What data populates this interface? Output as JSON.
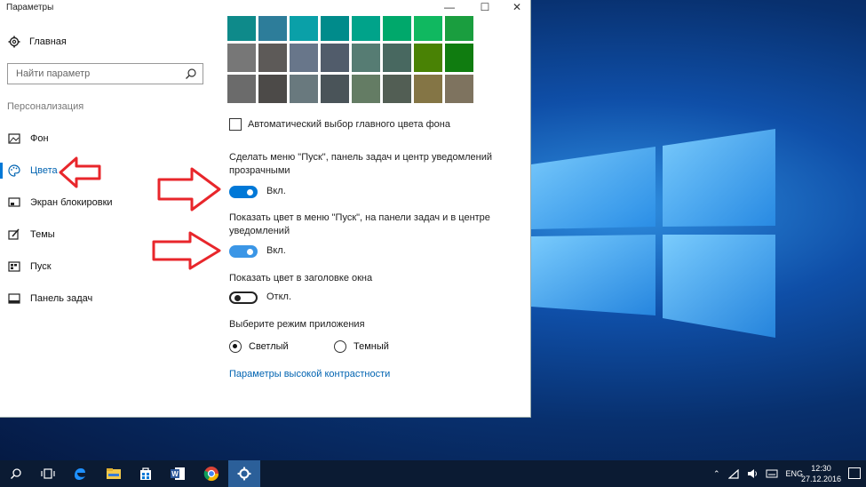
{
  "window": {
    "title": "Параметры",
    "minimize_glyph": "—",
    "maximize_glyph": "☐",
    "close_glyph": "✕"
  },
  "sidebar": {
    "home_label": "Главная",
    "search_placeholder": "Найти параметр",
    "section_title": "Персонализация",
    "items": [
      {
        "label": "Фон",
        "icon": "image-icon"
      },
      {
        "label": "Цвета",
        "icon": "palette-icon",
        "active": true
      },
      {
        "label": "Экран блокировки",
        "icon": "lock-screen-icon"
      },
      {
        "label": "Темы",
        "icon": "themes-icon"
      },
      {
        "label": "Пуск",
        "icon": "start-icon"
      },
      {
        "label": "Панель задач",
        "icon": "taskbar-icon"
      }
    ]
  },
  "colors": {
    "swatch_rows": [
      [
        "#0e8a8a",
        "#2d7d9a",
        "#0aa0a8",
        "#008b8b",
        "#00a38a",
        "#00a86b",
        "#10b860",
        "#1a9e3f"
      ],
      [
        "#777777",
        "#5d5a58",
        "#68768a",
        "#515c6b",
        "#567c73",
        "#486860",
        "#498205",
        "#107c10"
      ],
      [
        "#6b6b6b",
        "#4c4a48",
        "#69797e",
        "#4a5459",
        "#647c64",
        "#525e54",
        "#847545",
        "#7e735f"
      ]
    ],
    "auto_pick_label": "Автоматический выбор главного цвета фона",
    "transparency_label": "Сделать меню \"Пуск\", панель задач и центр уведомлений прозрачными",
    "transparency_state": "Вкл.",
    "show_color_label": "Показать цвет в меню \"Пуск\", на панели задач и в центре уведомлений",
    "show_color_state": "Вкл.",
    "titlebar_label": "Показать цвет в заголовке окна",
    "titlebar_state": "Откл.",
    "app_mode_label": "Выберите режим приложения",
    "mode_light": "Светлый",
    "mode_dark": "Темный",
    "selected_mode": "Светлый",
    "high_contrast_link": "Параметры высокой контрастности"
  },
  "taskbar": {
    "lang": "ENG",
    "time": "12:30",
    "date": "27.12.2016",
    "apps": [
      "search-icon",
      "task-view-icon",
      "edge-icon",
      "file-explorer-icon",
      "store-icon",
      "word-icon",
      "chrome-icon",
      "settings-icon"
    ]
  },
  "accent": "#0078d7",
  "annotation_color": "#e8262b"
}
